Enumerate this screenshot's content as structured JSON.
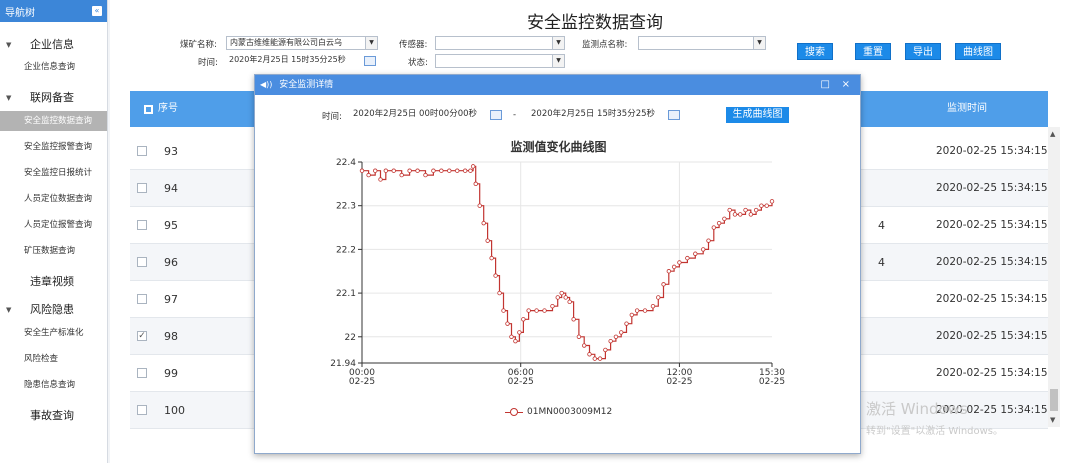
{
  "sidebar": {
    "title": "导航树",
    "collapse_icon": "double-chevron-left-icon",
    "groups": [
      {
        "label": "企业信息",
        "items": [
          "企业信息查询"
        ]
      },
      {
        "label": "联网备查",
        "items": [
          "安全监控数据查询",
          "安全监控报警查询",
          "安全监控日报统计",
          "人员定位数据查询",
          "人员定位报警查询",
          "矿压数据查询"
        ]
      },
      {
        "label": "违章视频",
        "items": []
      },
      {
        "label": "风险隐患",
        "items": [
          "安全生产标准化",
          "风险检查",
          "隐患信息查询"
        ]
      },
      {
        "label": "事故查询",
        "items": []
      }
    ],
    "active_item": "安全监控数据查询"
  },
  "page": {
    "title": "安全监控数据查询"
  },
  "filters": {
    "mine_label": "煤矿名称:",
    "mine_value": "内蒙古维维能源有限公司白云乌",
    "time_label": "时间:",
    "time_value": "2020年2月25日 15时35分25秒",
    "sensor_label": "传感器:",
    "sensor_value": "",
    "status_label": "状态:",
    "status_value": "",
    "point_label": "监测点名称:",
    "point_value": ""
  },
  "buttons": {
    "search": "搜索",
    "reset": "重置",
    "export": "导出",
    "curve": "曲线图"
  },
  "table": {
    "headers": {
      "seq": "序号",
      "time": "监测时间"
    },
    "rows": [
      {
        "seq": "93",
        "mid": "",
        "time": "2020-02-25 15:34:15",
        "checked": false
      },
      {
        "seq": "94",
        "mid": "",
        "time": "2020-02-25 15:34:15",
        "checked": false
      },
      {
        "seq": "95",
        "mid": "4",
        "time": "2020-02-25 15:34:15",
        "checked": false
      },
      {
        "seq": "96",
        "mid": "4",
        "time": "2020-02-25 15:34:15",
        "checked": false
      },
      {
        "seq": "97",
        "mid": "",
        "time": "2020-02-25 15:34:15",
        "checked": false
      },
      {
        "seq": "98",
        "mid": "",
        "time": "2020-02-25 15:34:15",
        "checked": true
      },
      {
        "seq": "99",
        "mid": "",
        "time": "2020-02-25 15:34:15",
        "checked": false
      },
      {
        "seq": "100",
        "mid": "",
        "time": "2020-02-25 15:34:15",
        "checked": false
      }
    ]
  },
  "watermark": {
    "line1": "激活 Windows",
    "line2": "转到\"设置\"以激活 Windows。"
  },
  "modal": {
    "title": "安全监测详情",
    "speaker_icon": "speaker-icon",
    "time_label": "时间:",
    "start_time": "2020年2月25日 00时00分00秒",
    "separator": "-",
    "end_time": "2020年2月25日 15时35分25秒",
    "generate_button": "生成曲线图",
    "maximize_icon": "maximize-icon",
    "close_icon": "close-icon"
  },
  "chart_data": {
    "type": "line",
    "title": "监测值变化曲线图",
    "ylim": [
      21.94,
      22.4
    ],
    "yticks": [
      "22.4",
      "22.3",
      "22.2",
      "22.1",
      "22",
      "21.94"
    ],
    "xticks": [
      {
        "time": "00:00",
        "date": "02-25"
      },
      {
        "time": "06:00",
        "date": "02-25"
      },
      {
        "time": "12:00",
        "date": "02-25"
      },
      {
        "time": "15:30",
        "date": "02-25"
      }
    ],
    "x_range_hours": [
      0,
      15.5
    ],
    "grid": true,
    "legend_position": "bottom-center",
    "color": "#c23531",
    "series": [
      {
        "name": "01MN0003009M12",
        "points": [
          [
            0.0,
            22.38
          ],
          [
            0.25,
            22.37
          ],
          [
            0.5,
            22.38
          ],
          [
            0.7,
            22.36
          ],
          [
            0.9,
            22.38
          ],
          [
            1.2,
            22.38
          ],
          [
            1.5,
            22.37
          ],
          [
            1.8,
            22.38
          ],
          [
            2.1,
            22.38
          ],
          [
            2.4,
            22.37
          ],
          [
            2.7,
            22.38
          ],
          [
            3.0,
            22.38
          ],
          [
            3.3,
            22.38
          ],
          [
            3.6,
            22.38
          ],
          [
            3.9,
            22.38
          ],
          [
            4.1,
            22.38
          ],
          [
            4.2,
            22.39
          ],
          [
            4.3,
            22.35
          ],
          [
            4.45,
            22.3
          ],
          [
            4.6,
            22.26
          ],
          [
            4.75,
            22.22
          ],
          [
            4.9,
            22.18
          ],
          [
            5.05,
            22.14
          ],
          [
            5.2,
            22.1
          ],
          [
            5.35,
            22.06
          ],
          [
            5.5,
            22.03
          ],
          [
            5.65,
            22.0
          ],
          [
            5.8,
            21.99
          ],
          [
            5.95,
            22.01
          ],
          [
            6.1,
            22.04
          ],
          [
            6.3,
            22.06
          ],
          [
            6.6,
            22.06
          ],
          [
            6.9,
            22.06
          ],
          [
            7.2,
            22.07
          ],
          [
            7.4,
            22.09
          ],
          [
            7.55,
            22.1
          ],
          [
            7.7,
            22.09
          ],
          [
            7.85,
            22.08
          ],
          [
            8.0,
            22.04
          ],
          [
            8.2,
            22.0
          ],
          [
            8.4,
            21.98
          ],
          [
            8.6,
            21.96
          ],
          [
            8.8,
            21.95
          ],
          [
            9.0,
            21.95
          ],
          [
            9.2,
            21.97
          ],
          [
            9.4,
            21.99
          ],
          [
            9.6,
            22.0
          ],
          [
            9.8,
            22.01
          ],
          [
            10.0,
            22.03
          ],
          [
            10.2,
            22.05
          ],
          [
            10.4,
            22.06
          ],
          [
            10.7,
            22.06
          ],
          [
            11.0,
            22.07
          ],
          [
            11.2,
            22.09
          ],
          [
            11.4,
            22.12
          ],
          [
            11.6,
            22.15
          ],
          [
            11.8,
            22.16
          ],
          [
            12.0,
            22.17
          ],
          [
            12.3,
            22.18
          ],
          [
            12.6,
            22.19
          ],
          [
            12.9,
            22.2
          ],
          [
            13.1,
            22.22
          ],
          [
            13.3,
            22.25
          ],
          [
            13.5,
            22.26
          ],
          [
            13.7,
            22.27
          ],
          [
            13.9,
            22.29
          ],
          [
            14.1,
            22.28
          ],
          [
            14.3,
            22.28
          ],
          [
            14.5,
            22.29
          ],
          [
            14.7,
            22.28
          ],
          [
            14.9,
            22.29
          ],
          [
            15.1,
            22.3
          ],
          [
            15.3,
            22.3
          ],
          [
            15.5,
            22.31
          ]
        ]
      }
    ]
  }
}
